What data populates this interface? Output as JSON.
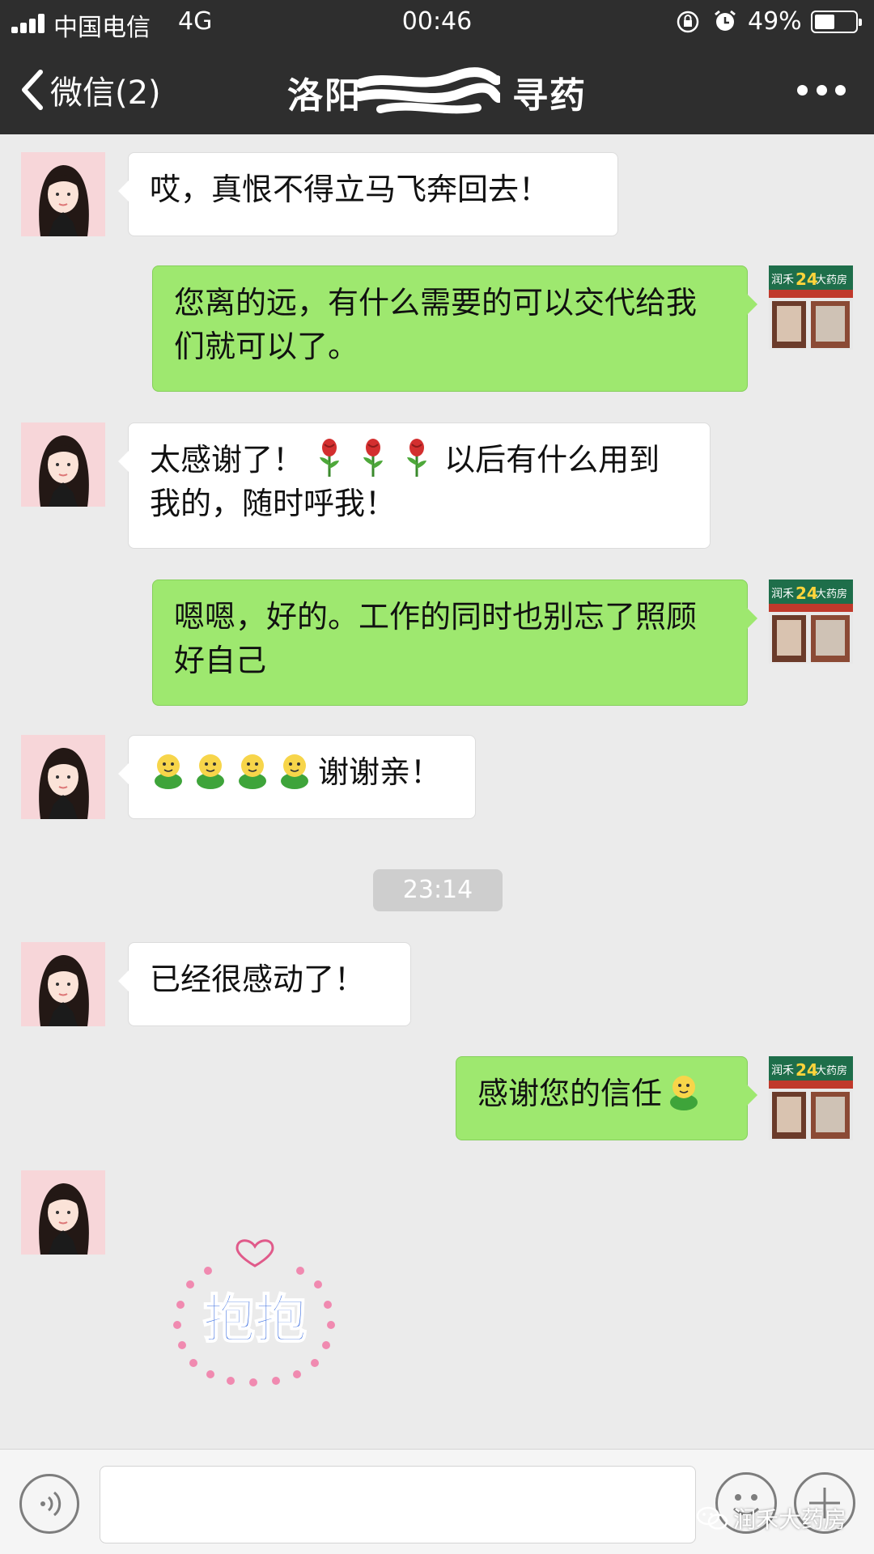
{
  "status_bar": {
    "carrier": "中国电信",
    "network": "4G",
    "time": "00:46",
    "battery_percent": "49%",
    "battery_level": 0.49
  },
  "nav": {
    "back_label": "微信(2)",
    "title_visible": "洛阳",
    "title_suffix": "寻药",
    "more_icon": "more-dots-icon"
  },
  "messages": [
    {
      "side": "left",
      "text": "哎，真恨不得立马飞奔回去！"
    },
    {
      "side": "right",
      "text": "您离的远，有什么需要的可以交代给我们就可以了。"
    },
    {
      "side": "left",
      "text_before": "太感谢了！",
      "emoji": "rose-emoji",
      "emoji_count": 3,
      "text_after": "以后有什么用到我的，随时呼我！"
    },
    {
      "side": "right",
      "text": "嗯嗯，好的。工作的同时也别忘了照顾好自己"
    },
    {
      "side": "left",
      "emoji": "smiley-emoji",
      "emoji_count": 4,
      "text_after": "谢谢亲！"
    },
    {
      "side": "left",
      "text": "已经很感动了！"
    },
    {
      "side": "right",
      "text": "感谢您的信任",
      "emoji": "smiley-emoji"
    },
    {
      "side": "left",
      "sticker_text": "抱抱"
    }
  ],
  "timestamp": "23:14",
  "shop_avatar": {
    "line1": "润禾",
    "number": "24",
    "line2": "大药房"
  },
  "watermark": "润禾大药房",
  "colors": {
    "header": "#2e2e2e",
    "chat_bg": "#ebebeb",
    "sent_bubble": "#9ee86f",
    "received_bubble": "#ffffff"
  }
}
